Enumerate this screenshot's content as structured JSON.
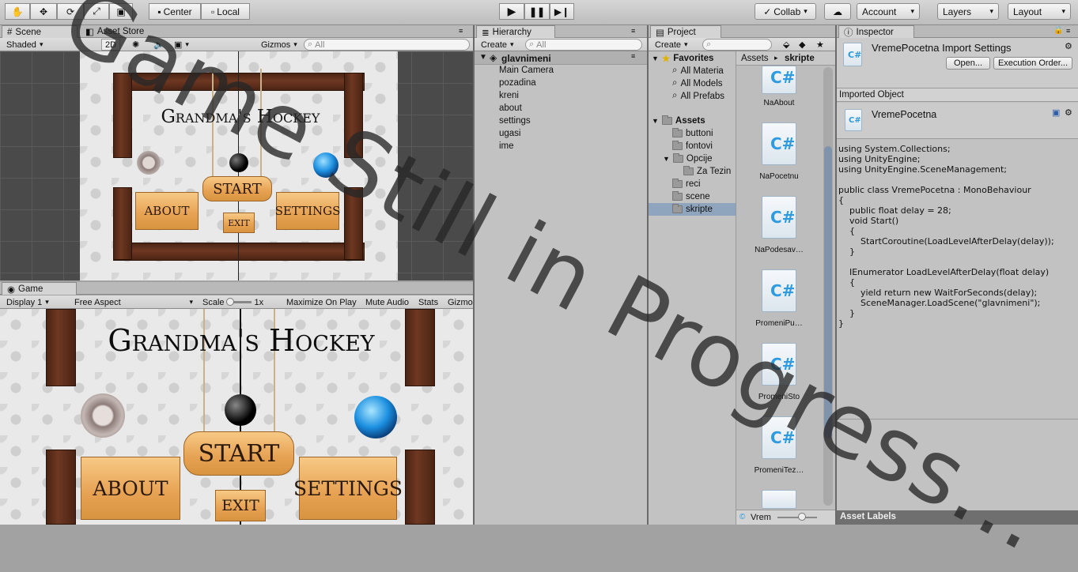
{
  "toolbar": {
    "pivot": "Center",
    "space": "Local",
    "collab": "Collab",
    "account": "Account",
    "layers": "Layers",
    "layout": "Layout"
  },
  "scene": {
    "tab": "Scene",
    "tab2": "Asset Store",
    "shading": "Shaded",
    "mode2d": "2D",
    "gizmos": "Gizmos",
    "search_placeholder": "All"
  },
  "game": {
    "tab": "Game",
    "display": "Display 1",
    "aspect": "Free Aspect",
    "scale_label": "Scale",
    "scale_value": "1x",
    "maximize": "Maximize On Play",
    "mute": "Mute Audio",
    "stats": "Stats",
    "gizmos": "Gizmo"
  },
  "game_content": {
    "title": "Grandma's Hockey",
    "start": "START",
    "about": "ABOUT",
    "settings": "SETTINGS",
    "exit": "EXIT"
  },
  "hierarchy": {
    "tab": "Hierarchy",
    "create": "Create",
    "search_placeholder": "All",
    "scene_name": "glavnimeni",
    "items": [
      "Main Camera",
      "pozadina",
      "kreni",
      "about",
      "settings",
      "ugasi",
      "ime"
    ]
  },
  "project": {
    "tab": "Project",
    "create": "Create",
    "favorites": "Favorites",
    "fav_items": [
      "All Materia",
      "All Models",
      "All Prefabs"
    ],
    "assets": "Assets",
    "folders": [
      "buttoni",
      "fontovi",
      "Opcije",
      "Za Tezin",
      "reci",
      "scene",
      "skripte"
    ],
    "breadcrumb_root": "Assets",
    "breadcrumb_current": "skripte",
    "files": [
      "NaAbout",
      "NaPocetnu",
      "NaPodesav…",
      "PromeniPu…",
      "PromeniSto",
      "PromeniTez…",
      ""
    ],
    "footer": "Vrem"
  },
  "inspector": {
    "tab": "Inspector",
    "title": "VremePocetna Import Settings",
    "open_btn": "Open...",
    "exec_btn": "Execution Order...",
    "imported_label": "Imported Object",
    "object_name": "VremePocetna",
    "asset_labels": "Asset Labels",
    "code": "using System.Collections;\nusing UnityEngine;\nusing UnityEngine.SceneManagement;\n\npublic class VremePocetna : MonoBehaviour\n{\n    public float delay = 28;\n    void Start()\n    {\n        StartCoroutine(LoadLevelAfterDelay(delay));\n    }\n\n    IEnumerator LoadLevelAfterDelay(float delay)\n    {\n        yield return new WaitForSeconds(delay);\n        SceneManager.LoadScene(\"glavnimeni\");\n    }\n}"
  },
  "watermark": "Game Still in Progress...",
  "colors": {
    "accent": "#3d8fd6",
    "selection": "#8fa5bd"
  }
}
